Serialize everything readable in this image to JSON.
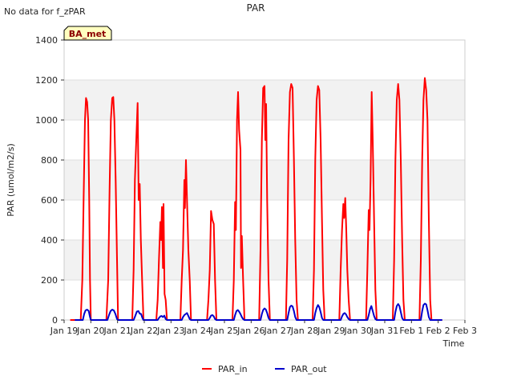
{
  "note": "No data for f_zPAR",
  "chart_data": {
    "type": "line",
    "title": "PAR",
    "xlabel": "Time",
    "ylabel": "PAR (umol/m2/s)",
    "ylim": [
      0,
      1400
    ],
    "yticks": [
      0,
      200,
      400,
      600,
      800,
      1000,
      1200,
      1400
    ],
    "xlim": [
      0,
      15
    ],
    "xticks": [
      0,
      1,
      2,
      3,
      4,
      5,
      6,
      7,
      8,
      9,
      10,
      11,
      12,
      13,
      14,
      15
    ],
    "xtick_labels": [
      "Jan 19",
      "Jan 20",
      "Jan 21",
      "Jan 22",
      "Jan 23",
      "Jan 24",
      "Jan 25",
      "Jan 26",
      "Jan 27",
      "Jan 28",
      "Jan 29",
      "Jan 30",
      "Jan 31",
      "Feb 1",
      "Feb 2",
      "Feb 3"
    ],
    "legend_position": "bottom",
    "background_bands": true,
    "site_label": "BA_met",
    "series": [
      {
        "name": "PAR_in",
        "color": "#ff0000",
        "points": [
          [
            0.4,
            0
          ],
          [
            0.25,
            0
          ],
          [
            0.25,
            0
          ],
          [
            0.45,
            0
          ],
          [
            0.62,
            0
          ],
          [
            0.68,
            200
          ],
          [
            0.73,
            600
          ],
          [
            0.78,
            1000
          ],
          [
            0.82,
            1110
          ],
          [
            0.86,
            1090
          ],
          [
            0.9,
            1000
          ],
          [
            0.94,
            600
          ],
          [
            0.97,
            200
          ],
          [
            1.0,
            0
          ],
          [
            1.58,
            0
          ],
          [
            1.65,
            200
          ],
          [
            1.7,
            650
          ],
          [
            1.75,
            1000
          ],
          [
            1.8,
            1110
          ],
          [
            1.84,
            1115
          ],
          [
            1.88,
            1000
          ],
          [
            1.93,
            700
          ],
          [
            1.98,
            300
          ],
          [
            2.02,
            0
          ],
          [
            2.55,
            0
          ],
          [
            2.6,
            250
          ],
          [
            2.65,
            700
          ],
          [
            2.7,
            900
          ],
          [
            2.75,
            1085
          ],
          [
            2.79,
            600
          ],
          [
            2.83,
            680
          ],
          [
            2.87,
            400
          ],
          [
            2.92,
            200
          ],
          [
            2.97,
            0
          ],
          [
            3.45,
            0
          ],
          [
            3.5,
            100
          ],
          [
            3.55,
            300
          ],
          [
            3.6,
            490
          ],
          [
            3.63,
            400
          ],
          [
            3.66,
            565
          ],
          [
            3.7,
            260
          ],
          [
            3.72,
            580
          ],
          [
            3.76,
            130
          ],
          [
            3.8,
            100
          ],
          [
            3.85,
            0
          ],
          [
            4.35,
            0
          ],
          [
            4.4,
            200
          ],
          [
            4.45,
            350
          ],
          [
            4.5,
            700
          ],
          [
            4.52,
            560
          ],
          [
            4.56,
            800
          ],
          [
            4.6,
            600
          ],
          [
            4.65,
            350
          ],
          [
            4.7,
            200
          ],
          [
            4.75,
            0
          ],
          [
            5.35,
            0
          ],
          [
            5.4,
            100
          ],
          [
            5.45,
            250
          ],
          [
            5.5,
            545
          ],
          [
            5.55,
            500
          ],
          [
            5.6,
            480
          ],
          [
            5.65,
            200
          ],
          [
            5.7,
            0
          ],
          [
            6.3,
            0
          ],
          [
            6.35,
            200
          ],
          [
            6.4,
            590
          ],
          [
            6.43,
            450
          ],
          [
            6.47,
            1000
          ],
          [
            6.51,
            1140
          ],
          [
            6.55,
            950
          ],
          [
            6.6,
            850
          ],
          [
            6.62,
            260
          ],
          [
            6.65,
            420
          ],
          [
            6.7,
            200
          ],
          [
            6.75,
            0
          ],
          [
            7.3,
            0
          ],
          [
            7.35,
            350
          ],
          [
            7.4,
            900
          ],
          [
            7.45,
            1160
          ],
          [
            7.5,
            1170
          ],
          [
            7.53,
            900
          ],
          [
            7.56,
            1080
          ],
          [
            7.6,
            600
          ],
          [
            7.65,
            200
          ],
          [
            7.7,
            0
          ],
          [
            8.3,
            0
          ],
          [
            8.35,
            300
          ],
          [
            8.4,
            900
          ],
          [
            8.45,
            1140
          ],
          [
            8.5,
            1180
          ],
          [
            8.55,
            1160
          ],
          [
            8.6,
            800
          ],
          [
            8.65,
            400
          ],
          [
            8.7,
            100
          ],
          [
            8.75,
            0
          ],
          [
            9.3,
            0
          ],
          [
            9.35,
            250
          ],
          [
            9.4,
            800
          ],
          [
            9.45,
            1100
          ],
          [
            9.5,
            1170
          ],
          [
            9.55,
            1150
          ],
          [
            9.6,
            900
          ],
          [
            9.65,
            500
          ],
          [
            9.7,
            150
          ],
          [
            9.75,
            0
          ],
          [
            10.3,
            0
          ],
          [
            10.35,
            250
          ],
          [
            10.4,
            450
          ],
          [
            10.45,
            580
          ],
          [
            10.48,
            510
          ],
          [
            10.52,
            610
          ],
          [
            10.56,
            450
          ],
          [
            10.6,
            250
          ],
          [
            10.65,
            100
          ],
          [
            10.7,
            0
          ],
          [
            11.3,
            0
          ],
          [
            11.35,
            250
          ],
          [
            11.4,
            550
          ],
          [
            11.43,
            450
          ],
          [
            11.47,
            700
          ],
          [
            11.51,
            1140
          ],
          [
            11.55,
            900
          ],
          [
            11.6,
            500
          ],
          [
            11.65,
            150
          ],
          [
            11.7,
            0
          ],
          [
            12.3,
            0
          ],
          [
            12.35,
            300
          ],
          [
            12.4,
            800
          ],
          [
            12.45,
            1100
          ],
          [
            12.5,
            1180
          ],
          [
            12.55,
            1100
          ],
          [
            12.6,
            800
          ],
          [
            12.65,
            400
          ],
          [
            12.7,
            100
          ],
          [
            12.75,
            0
          ],
          [
            13.3,
            0
          ],
          [
            13.35,
            300
          ],
          [
            13.4,
            800
          ],
          [
            13.45,
            1100
          ],
          [
            13.5,
            1210
          ],
          [
            13.55,
            1150
          ],
          [
            13.6,
            1000
          ],
          [
            13.65,
            500
          ],
          [
            13.7,
            100
          ],
          [
            13.75,
            0
          ],
          [
            14.15,
            0
          ]
        ]
      },
      {
        "name": "PAR_out",
        "color": "#0000cc",
        "points": [
          [
            0.4,
            0
          ],
          [
            0.7,
            0
          ],
          [
            0.75,
            30
          ],
          [
            0.8,
            48
          ],
          [
            0.86,
            52
          ],
          [
            0.92,
            45
          ],
          [
            0.97,
            15
          ],
          [
            1.0,
            0
          ],
          [
            1.62,
            0
          ],
          [
            1.68,
            25
          ],
          [
            1.74,
            45
          ],
          [
            1.8,
            52
          ],
          [
            1.86,
            48
          ],
          [
            1.92,
            30
          ],
          [
            1.98,
            5
          ],
          [
            2.02,
            0
          ],
          [
            2.6,
            0
          ],
          [
            2.66,
            20
          ],
          [
            2.72,
            42
          ],
          [
            2.78,
            45
          ],
          [
            2.83,
            32
          ],
          [
            2.88,
            30
          ],
          [
            2.93,
            10
          ],
          [
            2.97,
            0
          ],
          [
            3.5,
            0
          ],
          [
            3.55,
            10
          ],
          [
            3.6,
            18
          ],
          [
            3.65,
            20
          ],
          [
            3.7,
            15
          ],
          [
            3.75,
            22
          ],
          [
            3.8,
            5
          ],
          [
            3.85,
            0
          ],
          [
            4.4,
            0
          ],
          [
            4.45,
            15
          ],
          [
            4.5,
            25
          ],
          [
            4.55,
            30
          ],
          [
            4.6,
            35
          ],
          [
            4.65,
            20
          ],
          [
            4.7,
            5
          ],
          [
            4.75,
            0
          ],
          [
            5.4,
            0
          ],
          [
            5.45,
            10
          ],
          [
            5.5,
            22
          ],
          [
            5.55,
            25
          ],
          [
            5.6,
            18
          ],
          [
            5.65,
            5
          ],
          [
            5.7,
            0
          ],
          [
            6.35,
            0
          ],
          [
            6.4,
            25
          ],
          [
            6.45,
            45
          ],
          [
            6.5,
            50
          ],
          [
            6.55,
            42
          ],
          [
            6.6,
            30
          ],
          [
            6.65,
            15
          ],
          [
            6.7,
            5
          ],
          [
            6.75,
            0
          ],
          [
            7.35,
            0
          ],
          [
            7.4,
            30
          ],
          [
            7.45,
            50
          ],
          [
            7.5,
            58
          ],
          [
            7.55,
            52
          ],
          [
            7.6,
            35
          ],
          [
            7.65,
            10
          ],
          [
            7.7,
            0
          ],
          [
            8.35,
            0
          ],
          [
            8.4,
            35
          ],
          [
            8.45,
            65
          ],
          [
            8.5,
            72
          ],
          [
            8.55,
            68
          ],
          [
            8.6,
            45
          ],
          [
            8.65,
            15
          ],
          [
            8.7,
            0
          ],
          [
            9.35,
            0
          ],
          [
            9.4,
            35
          ],
          [
            9.45,
            60
          ],
          [
            9.5,
            75
          ],
          [
            9.55,
            65
          ],
          [
            9.6,
            40
          ],
          [
            9.65,
            10
          ],
          [
            9.7,
            0
          ],
          [
            10.35,
            0
          ],
          [
            10.4,
            18
          ],
          [
            10.45,
            30
          ],
          [
            10.5,
            35
          ],
          [
            10.55,
            28
          ],
          [
            10.6,
            15
          ],
          [
            10.65,
            5
          ],
          [
            10.7,
            0
          ],
          [
            11.35,
            0
          ],
          [
            11.4,
            25
          ],
          [
            11.45,
            55
          ],
          [
            11.5,
            70
          ],
          [
            11.55,
            45
          ],
          [
            11.6,
            20
          ],
          [
            11.65,
            5
          ],
          [
            11.7,
            0
          ],
          [
            12.35,
            0
          ],
          [
            12.4,
            40
          ],
          [
            12.45,
            70
          ],
          [
            12.5,
            80
          ],
          [
            12.55,
            70
          ],
          [
            12.6,
            40
          ],
          [
            12.65,
            10
          ],
          [
            12.7,
            0
          ],
          [
            13.35,
            0
          ],
          [
            13.4,
            45
          ],
          [
            13.45,
            75
          ],
          [
            13.5,
            82
          ],
          [
            13.55,
            78
          ],
          [
            13.6,
            50
          ],
          [
            13.65,
            15
          ],
          [
            13.7,
            0
          ],
          [
            14.15,
            0
          ]
        ]
      }
    ]
  }
}
